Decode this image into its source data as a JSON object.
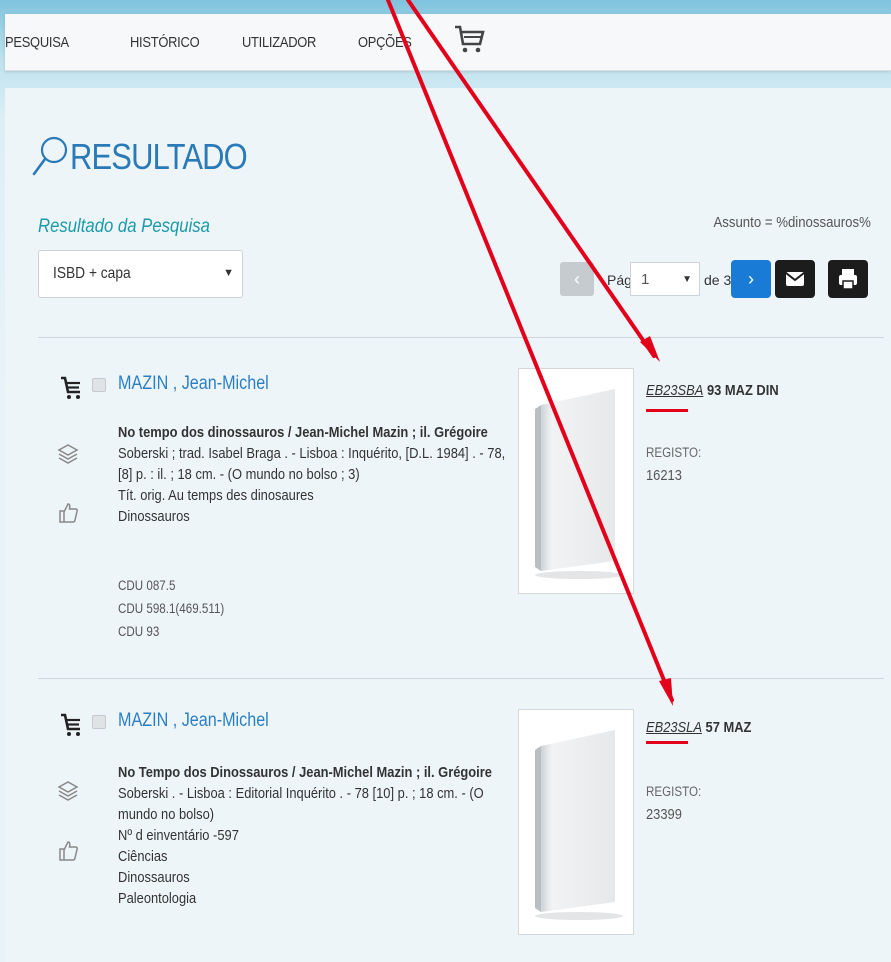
{
  "nav": {
    "items": [
      "PESQUISA",
      "HISTÓRICO",
      "UTILIZADOR",
      "OPÇÕES"
    ],
    "cart_icon": "cart-icon"
  },
  "header": {
    "title": "RESULTADO",
    "subtitle": "Resultado da Pesquisa",
    "query": "Assunto = %dinossauros%"
  },
  "view_select": {
    "value": "ISBD + capa"
  },
  "pager": {
    "page_label": "Pág",
    "page": "1",
    "of_label": "de 3"
  },
  "results": [
    {
      "author": "MAZIN , Jean-Michel",
      "desc_lines": [
        "No tempo dos dinossauros / Jean-Michel Mazin ; il. Grégoire",
        "Soberski ; trad. Isabel Braga . - Lisboa : Inquérito, [D.L. 1984] . - 78,",
        "[8] p. : il. ; 18 cm. - (O mundo no bolso ; 3)",
        "Tít. orig. Au temps des dinosaures",
        "Dinossauros"
      ],
      "cdu": [
        "CDU 087.5",
        "CDU 598.1(469.511)",
        "CDU 93"
      ],
      "call_italic": "EB23SBA",
      "call_rest": " 93 MAZ DIN",
      "registo_label": "REGISTO:",
      "registo": "16213"
    },
    {
      "author": "MAZIN , Jean-Michel",
      "desc_lines": [
        "No Tempo dos Dinossauros / Jean-Michel Mazin ; il. Grégoire",
        "Soberski . - Lisboa : Editorial Inquérito . - 78 [10] p. ; 18 cm. - (O",
        "mundo no bolso)",
        "Nº d einventário -597",
        "Ciências",
        "Dinossauros",
        "Paleontologia"
      ],
      "cdu": [],
      "call_italic": "EB23SLA",
      "call_rest": " 57 MAZ",
      "registo_label": "REGISTO:",
      "registo": "23399"
    }
  ],
  "colors": {
    "accent": "#2a7fc3",
    "annotation": "#e2001a",
    "teal": "#1b9aa8"
  }
}
